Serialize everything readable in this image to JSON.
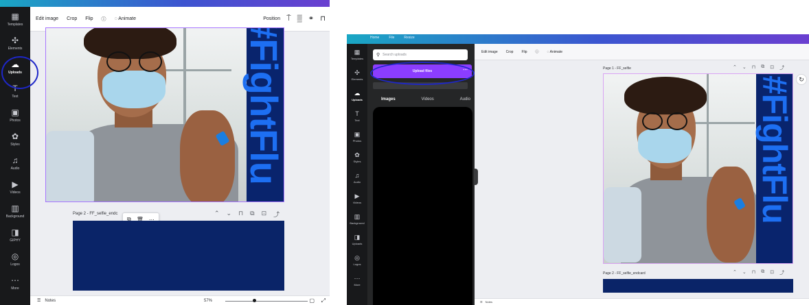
{
  "left_panel": {
    "sidebar": [
      {
        "icon": "▦",
        "label": "Templates"
      },
      {
        "icon": "✣",
        "label": "Elements"
      },
      {
        "icon": "☁",
        "label": "Uploads",
        "active": true
      },
      {
        "icon": "T",
        "label": "Text"
      },
      {
        "icon": "▣",
        "label": "Photos"
      },
      {
        "icon": "✿",
        "label": "Styles"
      },
      {
        "icon": "♫",
        "label": "Audio"
      },
      {
        "icon": "▶",
        "label": "Videos"
      },
      {
        "icon": "▥",
        "label": "Background"
      },
      {
        "icon": "◨",
        "label": "GIPHY"
      },
      {
        "icon": "◎",
        "label": "Logos"
      },
      {
        "icon": "⋯",
        "label": "More"
      }
    ],
    "toolbar": {
      "edit_image": "Edit image",
      "crop": "Crop",
      "flip": "Flip",
      "info": "ⓘ",
      "animate_icon": "◌",
      "animate": "Animate",
      "position": "Position"
    },
    "hashtag": "#FightFlu",
    "page2": {
      "label": "Page 2 - FF_selfie_endc",
      "popup": [
        "⧉",
        "🗑",
        "⋯"
      ]
    },
    "bottombar": {
      "notes": "Notes",
      "zoom": "57%"
    }
  },
  "right_panel": {
    "topnav": [
      "Home",
      "File",
      "Resize"
    ],
    "sidebar": [
      {
        "icon": "▦",
        "label": "Templates"
      },
      {
        "icon": "✣",
        "label": "Elements"
      },
      {
        "icon": "☁",
        "label": "Uploads",
        "active": true
      },
      {
        "icon": "T",
        "label": "Text"
      },
      {
        "icon": "▣",
        "label": "Photos"
      },
      {
        "icon": "✿",
        "label": "Styles"
      },
      {
        "icon": "♫",
        "label": "Audio"
      },
      {
        "icon": "▶",
        "label": "Videos"
      },
      {
        "icon": "▥",
        "label": "Background"
      },
      {
        "icon": "◨",
        "label": "Uploads"
      },
      {
        "icon": "◎",
        "label": "Logos"
      },
      {
        "icon": "⋯",
        "label": "More"
      }
    ],
    "search_placeholder": "Search uploads",
    "upload_button": "Upload files",
    "tabs": [
      "Images",
      "Videos",
      "Audio"
    ],
    "toolbar": {
      "edit_image": "Edit image",
      "crop": "Crop",
      "flip": "Flip",
      "info": "ⓘ",
      "animate_icon": "◌",
      "animate": "Animate"
    },
    "page1_label": "Page 1 - FF_selfie",
    "page2_label": "Page 2 - FF_selfie_endcard",
    "hashtag": "#FightFlu",
    "bottombar": {
      "notes": "Notes"
    }
  },
  "colors": {
    "accent_purple": "#8b3dff",
    "highlight_circle": "#1e27c8",
    "navy": "#0a2468",
    "hashtag_blue": "#1d6ff2"
  }
}
